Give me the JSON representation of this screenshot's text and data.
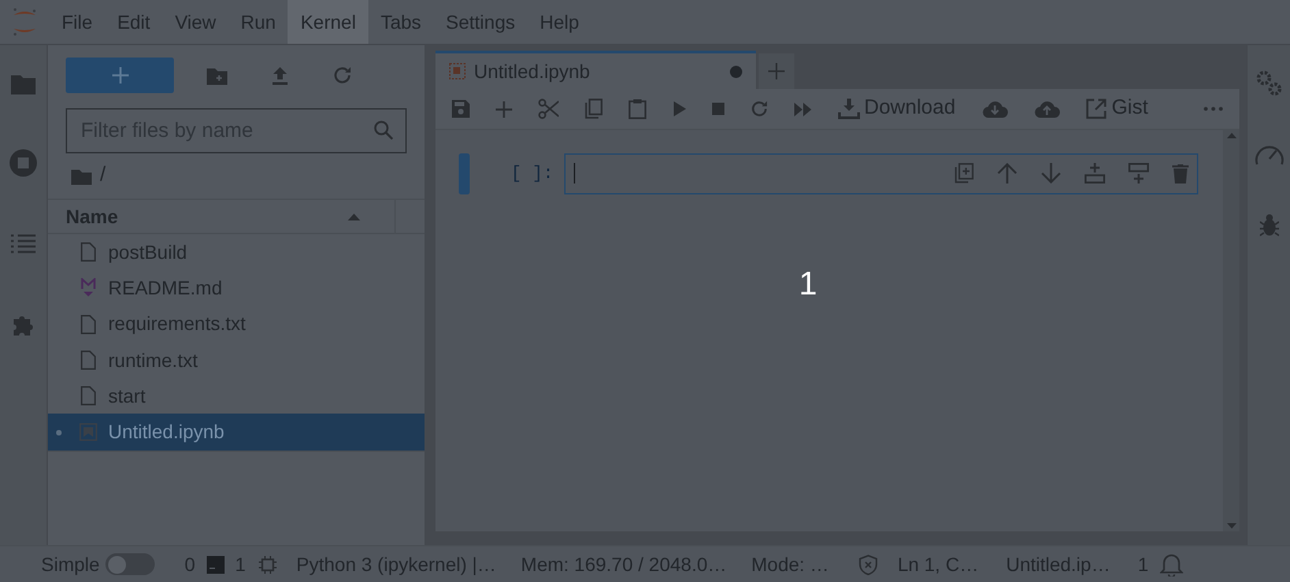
{
  "menu": [
    {
      "label": "File",
      "selected": false
    },
    {
      "label": "Edit",
      "selected": false
    },
    {
      "label": "View",
      "selected": false
    },
    {
      "label": "Run",
      "selected": false
    },
    {
      "label": "Kernel",
      "selected": true
    },
    {
      "label": "Tabs",
      "selected": false
    },
    {
      "label": "Settings",
      "selected": false
    },
    {
      "label": "Help",
      "selected": false
    }
  ],
  "file_browser": {
    "filter": {
      "placeholder": "Filter files by name"
    },
    "path": "/",
    "column": "Name",
    "files": [
      {
        "name": "postBuild",
        "kind": "file",
        "selected": false,
        "running": false
      },
      {
        "name": "README.md",
        "kind": "markdown",
        "selected": false,
        "running": false
      },
      {
        "name": "requirements.txt",
        "kind": "file",
        "selected": false,
        "running": false
      },
      {
        "name": "runtime.txt",
        "kind": "file",
        "selected": false,
        "running": false
      },
      {
        "name": "start",
        "kind": "file",
        "selected": false,
        "running": false
      },
      {
        "name": "Untitled.ipynb",
        "kind": "notebook",
        "selected": true,
        "running": true
      }
    ]
  },
  "tabs": [
    {
      "label": "Untitled.ipynb",
      "selected": true,
      "dirty": true
    }
  ],
  "toolbar": {
    "download": "Download",
    "gist": "Gist"
  },
  "cell": {
    "prompt": "[ ]:",
    "active": true
  },
  "step_marker": "1",
  "status_bar": {
    "simple_label": "Simple",
    "simple_on": false,
    "terminals": "0",
    "kernels": "1",
    "kernel": "Python 3 (ipykernel) |…",
    "memory": "Mem: 169.70 / 2048.0…",
    "mode": "Mode: …",
    "cursor": "Ln 1, C…",
    "file": "Untitled.ip…",
    "notifications": "1"
  }
}
